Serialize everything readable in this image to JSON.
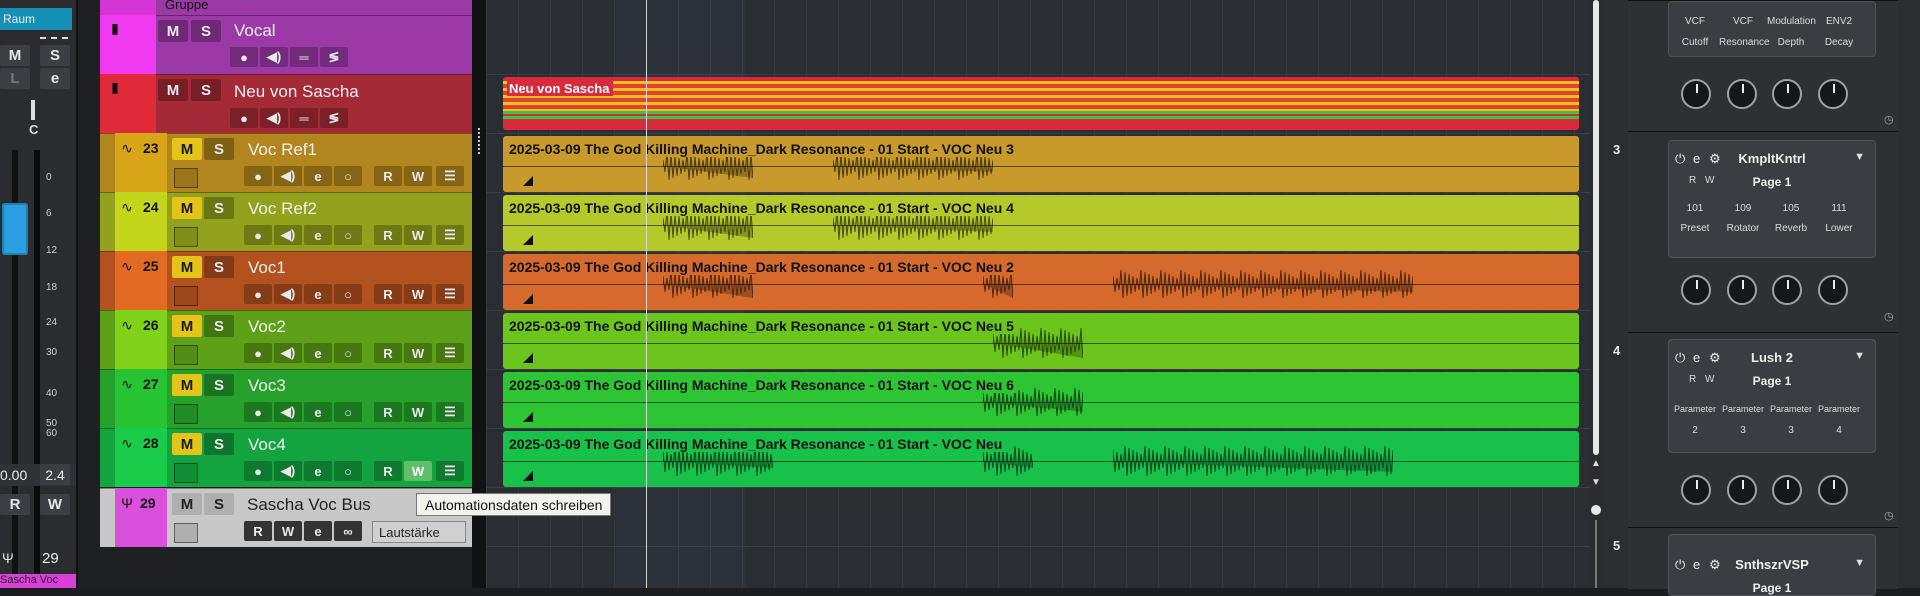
{
  "inspector": {
    "raum_label": "Raum",
    "m_label": "M",
    "s_label": "S",
    "l_label": "L",
    "e_label": "e",
    "pan_label": "C",
    "scale": [
      "0",
      "6",
      "12",
      "18",
      "24",
      "30",
      "40",
      "50",
      "60"
    ],
    "fader_value": "0.00",
    "meter_value": "2.4",
    "r_label": "R",
    "w_label": "W",
    "track_number": "29",
    "track_name": "Sascha Voc"
  },
  "tracks": [
    {
      "name": "Gruppe",
      "color": "#9b3aa6"
    },
    {
      "name": "Vocal",
      "color": "#9b3aa6"
    },
    {
      "name": "Neu von Sascha",
      "color": "#a52a37"
    },
    {
      "number": "23",
      "name": "Voc Ref1",
      "color": "#b2861e"
    },
    {
      "number": "24",
      "name": "Voc Ref2",
      "color": "#93a21c"
    },
    {
      "number": "25",
      "name": "Voc1",
      "color": "#b3521f"
    },
    {
      "number": "26",
      "name": "Voc2",
      "color": "#5ea119"
    },
    {
      "number": "27",
      "name": "Voc3",
      "color": "#25a12c"
    },
    {
      "number": "28",
      "name": "Voc4",
      "color": "#13a33f"
    },
    {
      "number": "29",
      "name": "Sascha Voc Bus",
      "color": "#c8c8c8",
      "volume_label": "Lautstärke"
    }
  ],
  "buttons": {
    "m": "M",
    "s": "S",
    "r": "R",
    "w": "W",
    "e": "e"
  },
  "events": [
    {
      "title": "Neu von Sascha"
    },
    {
      "title": "2025-03-09 The God Killing Machine_Dark Resonance - 01 Start - VOC Neu 3",
      "color": "#c79a2b"
    },
    {
      "title": "2025-03-09 The God Killing Machine_Dark Resonance - 01 Start - VOC Neu 4",
      "color": "#b5c92a"
    },
    {
      "title": "2025-03-09 The God Killing Machine_Dark Resonance - 01 Start - VOC Neu 2",
      "color": "#d56a2c"
    },
    {
      "title": "2025-03-09 The God Killing Machine_Dark Resonance - 01 Start - VOC Neu 5",
      "color": "#6bc51d"
    },
    {
      "title": "2025-03-09 The God Killing Machine_Dark Resonance - 01 Start - VOC Neu 6",
      "color": "#2ec534"
    },
    {
      "title": "2025-03-09 The God Killing Machine_Dark Resonance - 01 Start - VOC Neu",
      "color": "#18c24a"
    }
  ],
  "tooltip": "Automationsdaten schreiben",
  "quick_controls": [
    {
      "labels_top": [
        "VCF",
        "VCF",
        "Modulation",
        "ENV2"
      ],
      "labels_bottom": [
        "Cutoff",
        "Resonance",
        "Depth",
        "Decay"
      ]
    },
    {
      "slot": "3",
      "name": "KmpltKntrl",
      "page": "Page 1",
      "values": [
        "101",
        "109",
        "105",
        "111"
      ],
      "labels": [
        "Preset",
        "Rotator",
        "Reverb",
        "Lower"
      ]
    },
    {
      "slot": "4",
      "name": "Lush 2",
      "page": "Page 1",
      "labels": [
        "Parameter",
        "Parameter",
        "Parameter",
        "Parameter"
      ],
      "values": [
        "2",
        "3",
        "3",
        "4"
      ]
    },
    {
      "slot": "5",
      "name": "SnthszrVSP",
      "page": "Page 1"
    }
  ]
}
